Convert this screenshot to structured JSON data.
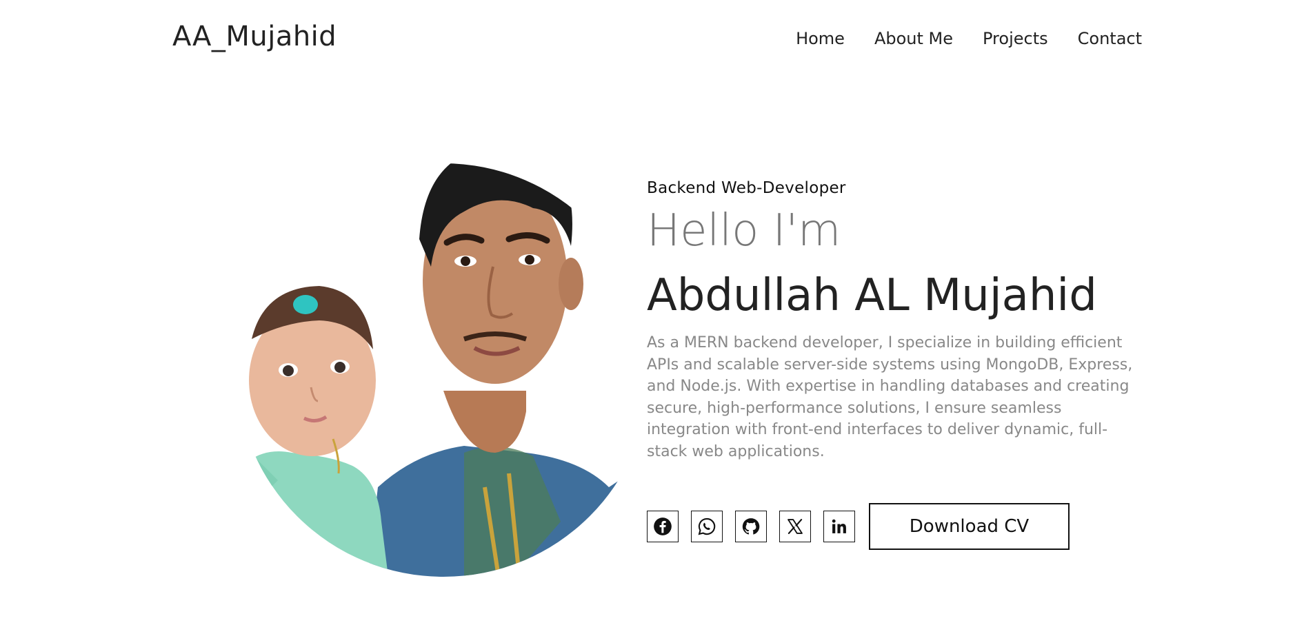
{
  "header": {
    "logo": "AA_Mujahid",
    "nav": [
      "Home",
      "About Me",
      "Projects",
      "Contact"
    ]
  },
  "hero": {
    "subtitle": "Backend Web-Developer",
    "greeting": "Hello I'm",
    "name": "Abdullah AL Mujahid",
    "bio": "As a MERN backend developer, I specialize in building efficient APIs and scalable server-side systems using MongoDB, Express, and Node.js. With expertise in handling databases and creating secure, high-performance solutions, I ensure seamless integration with front-end interfaces to deliver dynamic, full-stack web applications.",
    "social_icons": [
      "facebook-icon",
      "whatsapp-icon",
      "github-icon",
      "x-icon",
      "linkedin-icon"
    ],
    "download_label": "Download CV"
  },
  "colors": {
    "text_dark": "#222222",
    "text_muted": "#888888",
    "greeting_gray": "#777777",
    "background": "#ffffff"
  }
}
